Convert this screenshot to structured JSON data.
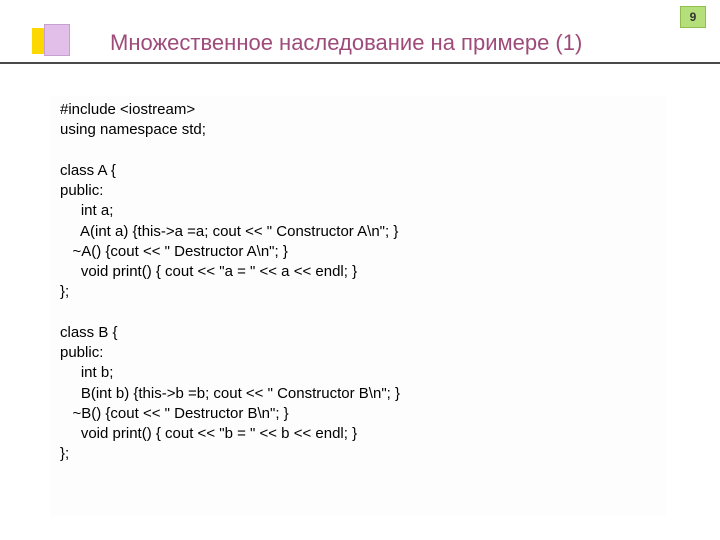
{
  "page_number": "9",
  "title": "Множественное наследование на примере (1)",
  "code": "#include <iostream>\nusing namespace std;\n\nclass A {\npublic:\n     int a;\n     A(int a) {this->a =a; cout << \" Constructor A\\n\"; }\n   ~A() {cout << \" Destructor A\\n\"; }\n     void print() { cout << \"a = \" << a << endl; }\n};\n\nclass B {\npublic:\n     int b;\n     B(int b) {this->b =b; cout << \" Constructor B\\n\"; }\n   ~B() {cout << \" Destructor B\\n\"; }\n     void print() { cout << \"b = \" << b << endl; }\n};"
}
